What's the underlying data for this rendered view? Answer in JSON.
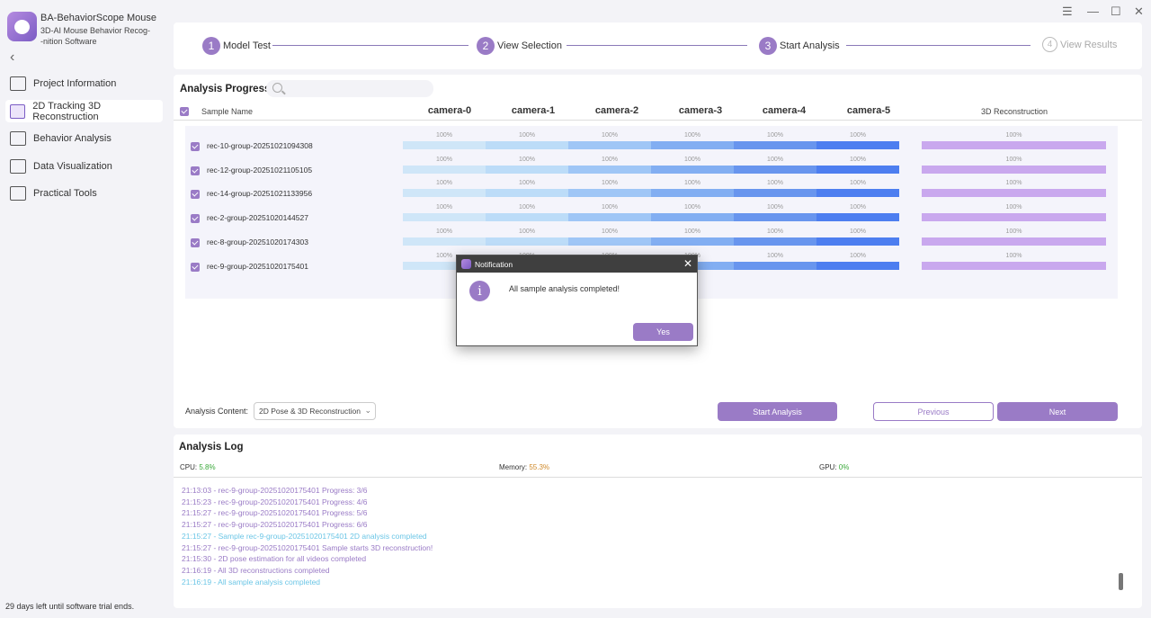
{
  "app": {
    "title": "BA-BehaviorScope Mouse",
    "subtitle": "3D-AI Mouse Behavior Recog-\n-nition Software",
    "trial_text": "29 days left until software trial ends."
  },
  "sidebar": {
    "items": [
      {
        "label": "Project Information",
        "icon": "terminal-icon"
      },
      {
        "label": "2D Tracking 3D Reconstruction",
        "icon": "cube-icon",
        "active": true
      },
      {
        "label": "Behavior Analysis",
        "icon": "chart-icon"
      },
      {
        "label": "Data Visualization",
        "icon": "checklist-icon"
      },
      {
        "label": "Practical Tools",
        "icon": "tools-icon"
      }
    ]
  },
  "window_controls": {
    "menu": "☰",
    "minimize": "—",
    "maximize": "☐",
    "close": "✕"
  },
  "steps": [
    {
      "num": "1",
      "label": "Model Test",
      "state": "done"
    },
    {
      "num": "2",
      "label": "View Selection",
      "state": "done"
    },
    {
      "num": "3",
      "label": "Start Analysis",
      "state": "current"
    },
    {
      "num": "4",
      "label": "View Results",
      "state": "pending"
    }
  ],
  "progress": {
    "title": "Analysis Progress",
    "header_sample": "Sample Name",
    "cameras": [
      "camera-0",
      "camera-1",
      "camera-2",
      "camera-3",
      "camera-4",
      "camera-5"
    ],
    "camera_colors": [
      "#cfe6f8",
      "#bcdcf8",
      "#9fc6f6",
      "#82aef2",
      "#6895ee",
      "#4d7ef0"
    ],
    "recon_header": "3D Reconstruction",
    "recon_color": "#c9a8ee",
    "rows": [
      {
        "name": "rec-10-group-20251021094308",
        "cams": [
          1,
          1,
          1,
          1,
          1,
          1
        ],
        "cam_pct": [
          "100%",
          "100%",
          "100%",
          "100%",
          "100%",
          "100%"
        ],
        "recon": 1,
        "recon_pct": "100%"
      },
      {
        "name": "rec-12-group-20251021105105",
        "cams": [
          1,
          1,
          1,
          1,
          1,
          1
        ],
        "cam_pct": [
          "100%",
          "100%",
          "100%",
          "100%",
          "100%",
          "100%"
        ],
        "recon": 1,
        "recon_pct": "100%"
      },
      {
        "name": "rec-14-group-20251021133956",
        "cams": [
          1,
          1,
          1,
          1,
          1,
          1
        ],
        "cam_pct": [
          "100%",
          "100%",
          "100%",
          "100%",
          "100%",
          "100%"
        ],
        "recon": 1,
        "recon_pct": "100%"
      },
      {
        "name": "rec-2-group-20251020144527",
        "cams": [
          1,
          1,
          1,
          1,
          1,
          1
        ],
        "cam_pct": [
          "100%",
          "100%",
          "100%",
          "100%",
          "100%",
          "100%"
        ],
        "recon": 1,
        "recon_pct": "100%"
      },
      {
        "name": "rec-8-group-20251020174303",
        "cams": [
          1,
          1,
          1,
          1,
          1,
          1
        ],
        "cam_pct": [
          "100%",
          "100%",
          "100%",
          "100%",
          "100%",
          "100%"
        ],
        "recon": 1,
        "recon_pct": "100%"
      },
      {
        "name": "rec-9-group-20251020175401",
        "cams": [
          1,
          1,
          1,
          1,
          1,
          1
        ],
        "cam_pct": [
          "100%",
          "100%",
          "100%",
          "100%",
          "100%",
          "100%"
        ],
        "recon": 1,
        "recon_pct": "100%"
      }
    ],
    "content_label": "Analysis Content:",
    "content_value": "2D Pose & 3D Reconstruction",
    "start_button": "Start Analysis",
    "previous_button": "Previous",
    "next_button": "Next"
  },
  "log": {
    "title": "Analysis Log",
    "cpu_label": "CPU:",
    "cpu_value": "5.8%",
    "cpu_color": "#3aa83a",
    "mem_label": "Memory:",
    "mem_value": "55.3%",
    "mem_color": "#d08a2a",
    "gpu_label": "GPU:",
    "gpu_value": "0%",
    "gpu_color": "#3aa83a",
    "lines": [
      {
        "text": "21:13:03 - rec-9-group-20251020175401 Progress: 3/6",
        "color": "#9a7bc6"
      },
      {
        "text": "21:15:23 - rec-9-group-20251020175401 Progress: 4/6",
        "color": "#9a7bc6"
      },
      {
        "text": "21:15:27 - rec-9-group-20251020175401 Progress: 5/6",
        "color": "#9a7bc6"
      },
      {
        "text": "21:15:27 - rec-9-group-20251020175401 Progress: 6/6",
        "color": "#9a7bc6"
      },
      {
        "text": "21:15:27 - Sample rec-9-group-20251020175401 2D analysis completed",
        "color": "#6cc6e6"
      },
      {
        "text": "21:15:27 - rec-9-group-20251020175401 Sample starts 3D reconstruction!",
        "color": "#9a7bc6"
      },
      {
        "text": "21:15:30 - 2D pose estimation for all videos completed",
        "color": "#9a7bc6"
      },
      {
        "text": "21:16:19 - All 3D reconstructions completed",
        "color": "#9a7bc6"
      },
      {
        "text": "21:16:19 - All sample analysis completed",
        "color": "#6cc6e6"
      }
    ]
  },
  "dialog": {
    "title": "Notification",
    "message": "All sample analysis completed!",
    "yes_button": "Yes",
    "close": "✕",
    "info_glyph": "i"
  },
  "glyphs": {
    "back": "‹",
    "chevron": "⌄"
  }
}
